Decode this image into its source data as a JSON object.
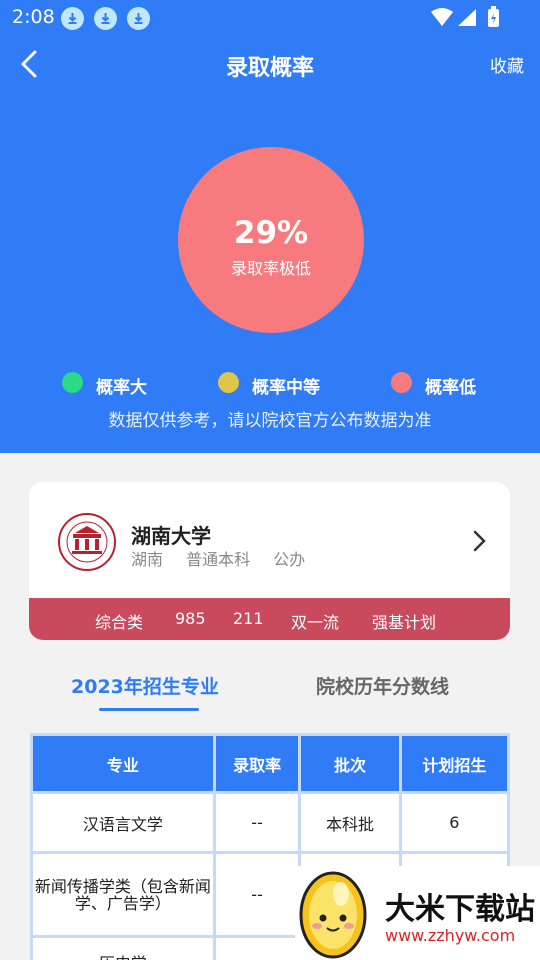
{
  "status_bar": {
    "time": "2:08"
  },
  "header": {
    "title": "录取概率",
    "favorite_label": "收藏"
  },
  "probability": {
    "percent": "29%",
    "label": "录取率极低",
    "value": 0.29,
    "color": "#f77b7e"
  },
  "legend": [
    {
      "label": "概率大",
      "color": "#2bd98b"
    },
    {
      "label": "概率中等",
      "color": "#dcc74a"
    },
    {
      "label": "概率低",
      "color": "#f77b7e"
    }
  ],
  "disclaimer": "数据仅供参考，请以院校官方公布数据为准",
  "university": {
    "name": "湖南大学",
    "location": "湖南",
    "level": "普通本科",
    "ownership": "公办",
    "tags": [
      "综合类",
      "985",
      "211",
      "双一流",
      "强基计划"
    ]
  },
  "tabs": [
    {
      "label": "2023年招生专业",
      "active": true
    },
    {
      "label": "院校历年分数线",
      "active": false
    }
  ],
  "table": {
    "headers": [
      "专业",
      "录取率",
      "批次",
      "计划招生"
    ],
    "rows": [
      [
        "汉语言文学",
        "--",
        "本科批",
        "6"
      ],
      [
        "新闻传播学类（包含新闻学、广告学）",
        "--",
        "",
        ""
      ],
      [
        "历史学",
        "",
        "",
        ""
      ]
    ]
  },
  "watermark": {
    "title": "大米下载站",
    "url": "www.zzhyw.com"
  },
  "colors": {
    "primary": "#2f7cf6",
    "tag_bar": "#c9495d",
    "background": "#f2f2f2"
  }
}
